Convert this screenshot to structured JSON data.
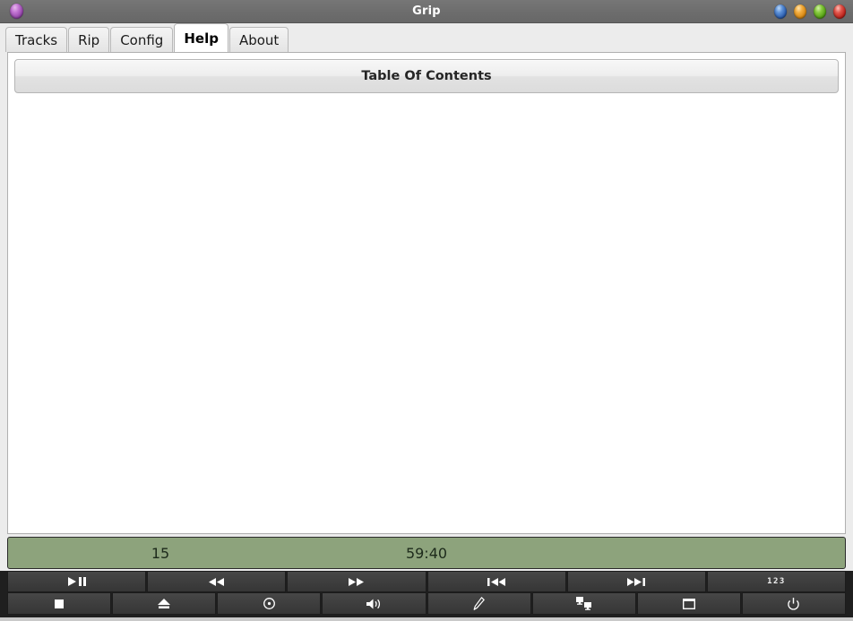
{
  "window": {
    "title": "Grip",
    "app_icon": "grip-orb-icon",
    "controls": [
      {
        "name": "shade-button",
        "color": "#3f7ad0"
      },
      {
        "name": "minimize-button",
        "color": "#e69b2c"
      },
      {
        "name": "maximize-button",
        "color": "#6cbb22"
      },
      {
        "name": "close-button",
        "color": "#cf3328"
      }
    ]
  },
  "tabs": [
    {
      "label": "Tracks",
      "active": false
    },
    {
      "label": "Rip",
      "active": false
    },
    {
      "label": "Config",
      "active": false
    },
    {
      "label": "Help",
      "active": true
    },
    {
      "label": "About",
      "active": false
    }
  ],
  "help": {
    "toc_button_label": "Table Of Contents",
    "body_text": ""
  },
  "lcd": {
    "track_number": "15",
    "time": "59:40",
    "background_color": "#8da37c",
    "text_color": "#1d2a1b"
  },
  "transport": {
    "row1": [
      {
        "name": "play-pause-button",
        "icon": "play-pause-icon",
        "label": ""
      },
      {
        "name": "rewind-button",
        "icon": "rewind-icon",
        "label": ""
      },
      {
        "name": "fast-forward-button",
        "icon": "fast-forward-icon",
        "label": ""
      },
      {
        "name": "previous-track-button",
        "icon": "previous-track-icon",
        "label": ""
      },
      {
        "name": "next-track-button",
        "icon": "next-track-icon",
        "label": ""
      },
      {
        "name": "track-number-button",
        "icon": "digits-icon",
        "label": "123"
      }
    ],
    "row2": [
      {
        "name": "stop-button",
        "icon": "stop-icon",
        "label": ""
      },
      {
        "name": "eject-button",
        "icon": "eject-icon",
        "label": ""
      },
      {
        "name": "disc-button",
        "icon": "disc-icon",
        "label": ""
      },
      {
        "name": "volume-button",
        "icon": "volume-icon",
        "label": ""
      },
      {
        "name": "edit-button",
        "icon": "pencil-icon",
        "label": ""
      },
      {
        "name": "cddb-scan-button",
        "icon": "network-icon",
        "label": ""
      },
      {
        "name": "minimize-view-button",
        "icon": "window-icon",
        "label": ""
      },
      {
        "name": "power-button",
        "icon": "power-icon",
        "label": ""
      }
    ]
  }
}
